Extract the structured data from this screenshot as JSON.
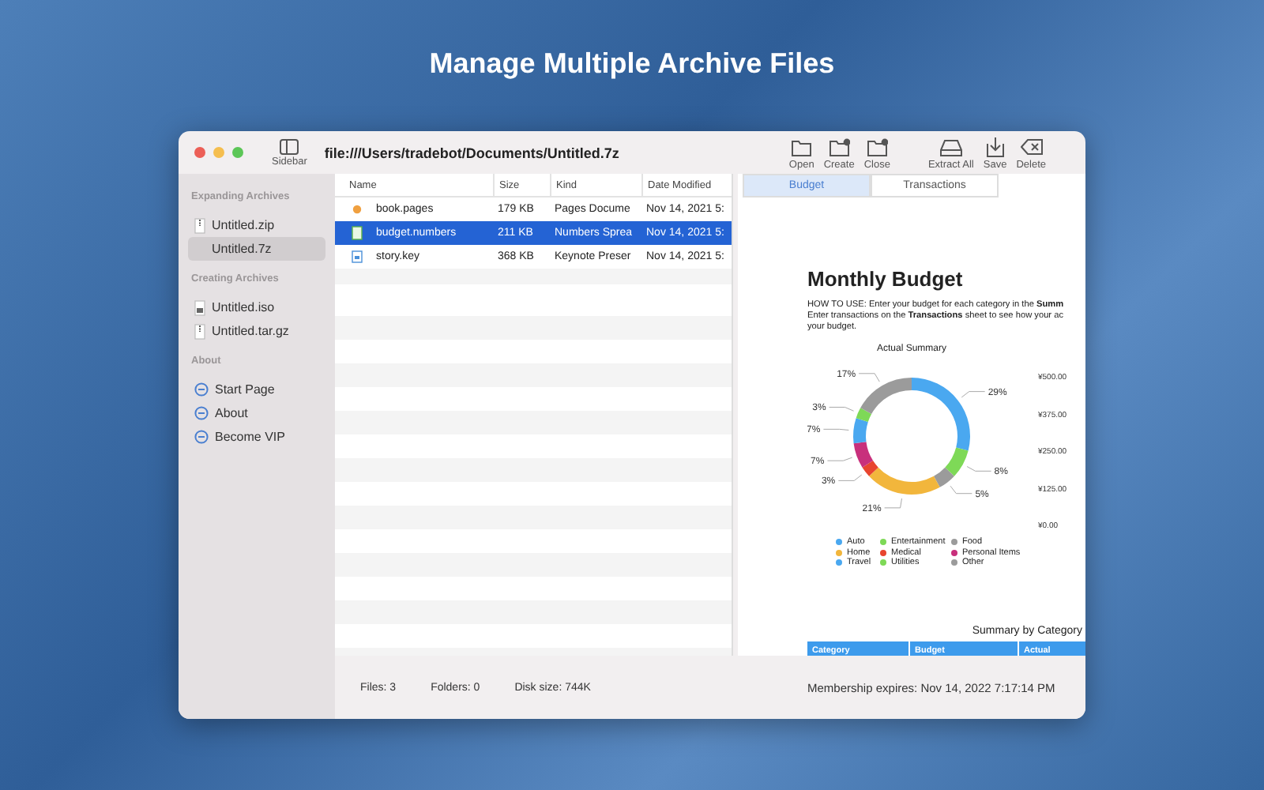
{
  "banner": {
    "title": "Manage Multiple Archive Files"
  },
  "window": {
    "title": "file:///Users/tradebot/Documents/Untitled.7z",
    "sidebar_toggle": "Sidebar"
  },
  "toolbar": [
    {
      "label": "Open",
      "kind": "open"
    },
    {
      "label": "Create",
      "kind": "create"
    },
    {
      "label": "Close",
      "kind": "close"
    },
    {
      "label": "Extract All",
      "kind": "extract"
    },
    {
      "label": "Save",
      "kind": "save"
    },
    {
      "label": "Delete",
      "kind": "delete"
    }
  ],
  "sidebar": {
    "sections": [
      {
        "title": "Expanding Archives",
        "items": [
          {
            "label": "Untitled.zip",
            "kind": "zip",
            "selected": false
          },
          {
            "label": "Untitled.7z",
            "kind": "none",
            "selected": true
          }
        ]
      },
      {
        "title": "Creating Archives",
        "items": [
          {
            "label": "Untitled.iso",
            "kind": "disk",
            "selected": false
          },
          {
            "label": "Untitled.tar.gz",
            "kind": "zip",
            "selected": false
          }
        ]
      },
      {
        "title": "About",
        "items": [
          {
            "label": "Start Page",
            "kind": "link",
            "selected": false
          },
          {
            "label": "About",
            "kind": "link",
            "selected": false
          },
          {
            "label": "Become VIP",
            "kind": "link",
            "selected": false
          }
        ]
      }
    ]
  },
  "table": {
    "columns": [
      "Name",
      "Size",
      "Kind",
      "Date Modified"
    ],
    "rows": [
      {
        "name": "book.pages",
        "kind": "pages",
        "size": "179 KB",
        "kind_column": "Pages Docume",
        "date": "Nov 14, 2021 5:",
        "selected": false
      },
      {
        "name": "budget.numbers",
        "kind": "numbers",
        "size": "211 KB",
        "kind_column": "Numbers Sprea",
        "date": "Nov 14, 2021 5:",
        "selected": true
      },
      {
        "name": "story.key",
        "kind": "keynote",
        "size": "368 KB",
        "kind_column": "Keynote Preser",
        "date": "Nov 14, 2021 5:",
        "selected": false
      }
    ]
  },
  "preview": {
    "tabs": [
      {
        "label": "Budget",
        "selected": true
      },
      {
        "label": "Transactions",
        "selected": false
      }
    ],
    "heading": "Monthly Budget",
    "instructions": "HOW TO USE: Enter your budget for each category in the **Summ**\nEnter transactions on the **Transactions** sheet to see how your ac\nyour budget.",
    "chart_data": {
      "type": "donut",
      "title": "Actual Summary",
      "categories": [
        "Auto",
        "Entertainment",
        "Food",
        "Home",
        "Medical",
        "Personal Items",
        "Travel",
        "Utilities",
        "Other"
      ],
      "series": [
        {
          "values": [
            29,
            8,
            5,
            21,
            3,
            7,
            7,
            3,
            17
          ]
        }
      ],
      "colors": [
        "#4aa8f0",
        "#7ed957",
        "#9b9b9b",
        "#f2b63c",
        "#e8452f",
        "#c8307c",
        "#4aa8f0",
        "#7ed957",
        "#9b9b9b"
      ],
      "value_labels": [
        "29%",
        "8%",
        "5%",
        "21%",
        "3%",
        "7%",
        "7%",
        "3%",
        "17%"
      ]
    },
    "axis_labels": [
      "¥500.00",
      "¥375.00",
      "¥250.00",
      "¥125.00",
      "¥0.00"
    ],
    "summary_title": "Summary by Category",
    "summary_columns": [
      "Category",
      "Budget",
      "Actual"
    ]
  },
  "status_bar": {
    "files": "Files: 3",
    "folders": "Folders: 0",
    "disk_size": "Disk size: 744K",
    "membership": "Membership expires: Nov 14, 2022 7:17:14 PM"
  }
}
